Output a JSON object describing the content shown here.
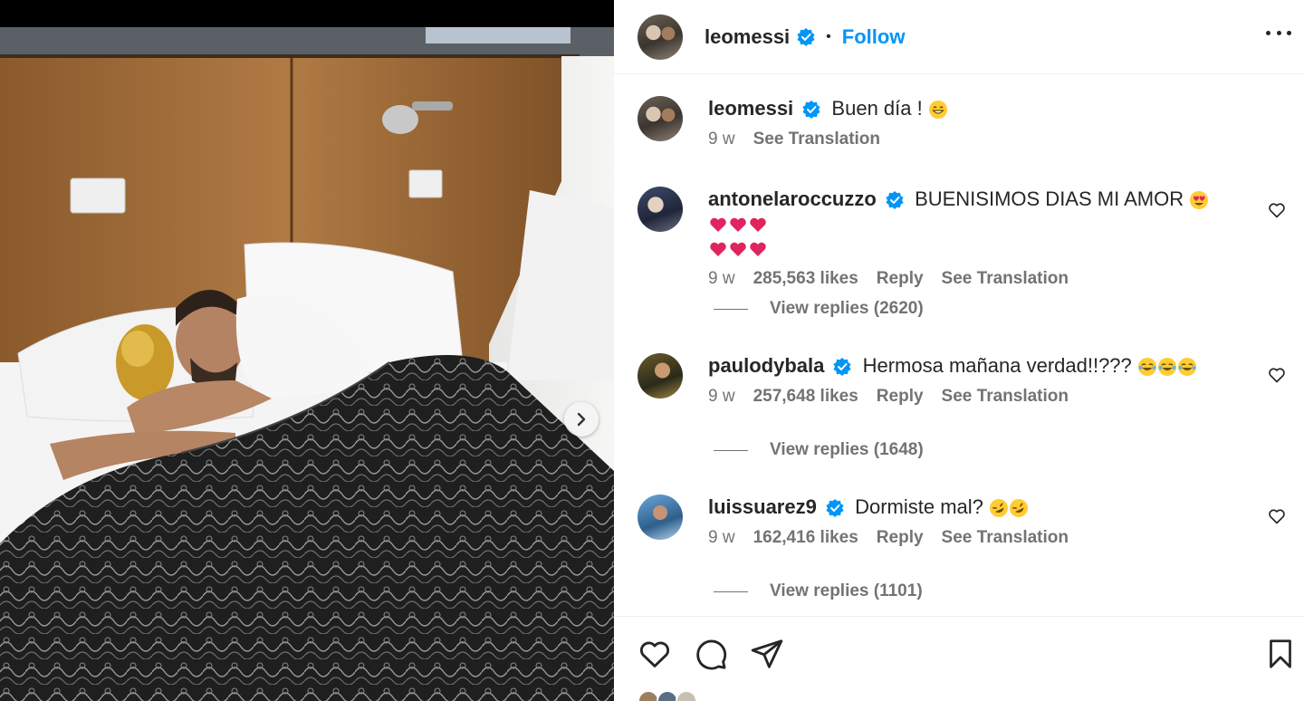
{
  "post": {
    "username": "leomessi",
    "follow_label": "Follow",
    "dot": "•"
  },
  "caption": {
    "username": "leomessi",
    "text": "Buen día !",
    "time": "9 w",
    "translation": "See Translation"
  },
  "comments": [
    {
      "username": "antonelaroccuzzo",
      "text": "BUENISIMOS DIAS MI AMOR",
      "time": "9 w",
      "likes": "285,563 likes",
      "reply": "Reply",
      "translation": "See Translation",
      "view_replies": "View replies (2620)"
    },
    {
      "username": "paulodybala",
      "text": "Hermosa mañana verdad!!???",
      "time": "9 w",
      "likes": "257,648 likes",
      "reply": "Reply",
      "translation": "See Translation",
      "view_replies": "View replies (1648)"
    },
    {
      "username": "luissuarez9",
      "text": "Dormiste mal?",
      "time": "9 w",
      "likes": "162,416 likes",
      "reply": "Reply",
      "translation": "See Translation",
      "view_replies": "View replies (1101)"
    }
  ],
  "icons": {
    "verified": "verified-badge-icon",
    "more": "more-options-icon",
    "like": "heart-icon",
    "comment": "comment-icon",
    "share": "share-icon",
    "save": "bookmark-icon",
    "next": "chevron-right-icon"
  },
  "colors": {
    "accent": "#0095f6",
    "text": "#262626",
    "muted": "#737373",
    "verified": "#0095f6"
  }
}
